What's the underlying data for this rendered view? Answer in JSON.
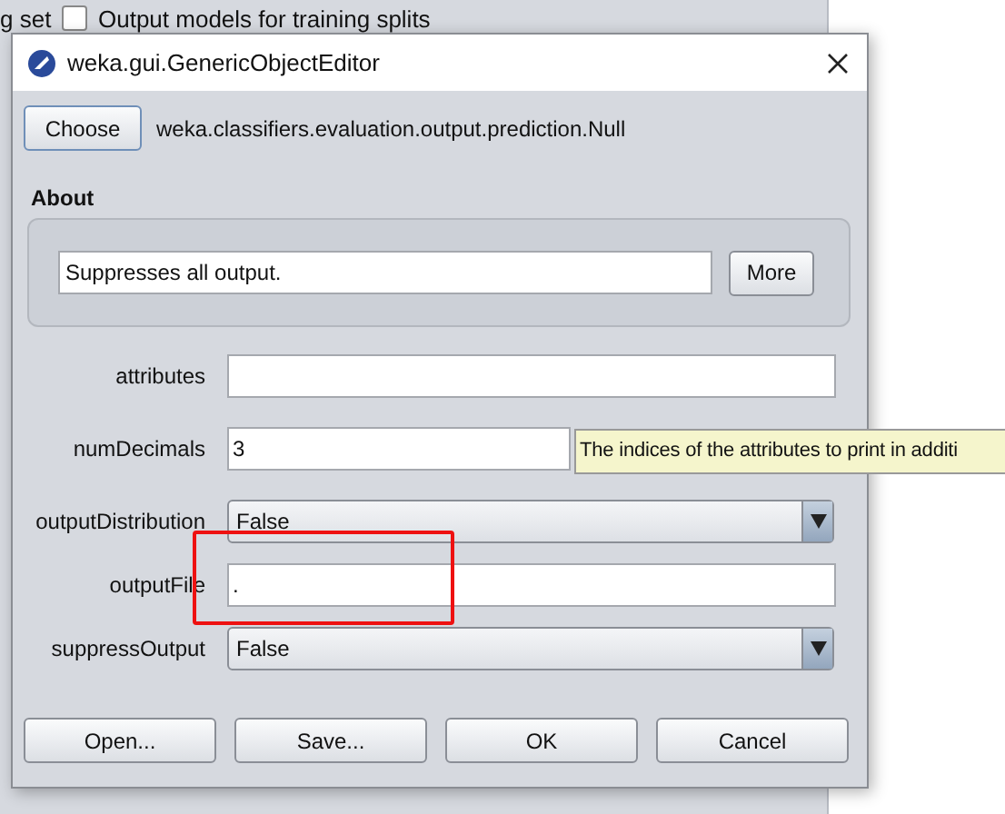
{
  "background_window": {
    "partial_label": "g set",
    "checkbox": {
      "label": "Output models for training splits",
      "checked": false
    }
  },
  "dialog": {
    "title": "weka.gui.GenericObjectEditor",
    "choose_button": "Choose",
    "class_name": "weka.classifiers.evaluation.output.prediction.Null",
    "about": {
      "heading": "About",
      "description": "Suppresses all output.",
      "more_button": "More"
    },
    "properties": [
      {
        "label": "attributes",
        "kind": "text"
      },
      {
        "label": "numDecimals",
        "kind": "text",
        "value": "3"
      },
      {
        "label": "outputDistribution",
        "kind": "dropdown",
        "value": "False"
      },
      {
        "label": "outputFile",
        "kind": "text",
        "value": "."
      },
      {
        "label": "suppressOutput",
        "kind": "dropdown",
        "value": "False"
      }
    ],
    "buttons": [
      "Open...",
      "Save...",
      "OK",
      "Cancel"
    ]
  },
  "tooltip": "The indices of the attributes to print in additi",
  "annotations": [
    {
      "kind": "rectangle"
    }
  ]
}
